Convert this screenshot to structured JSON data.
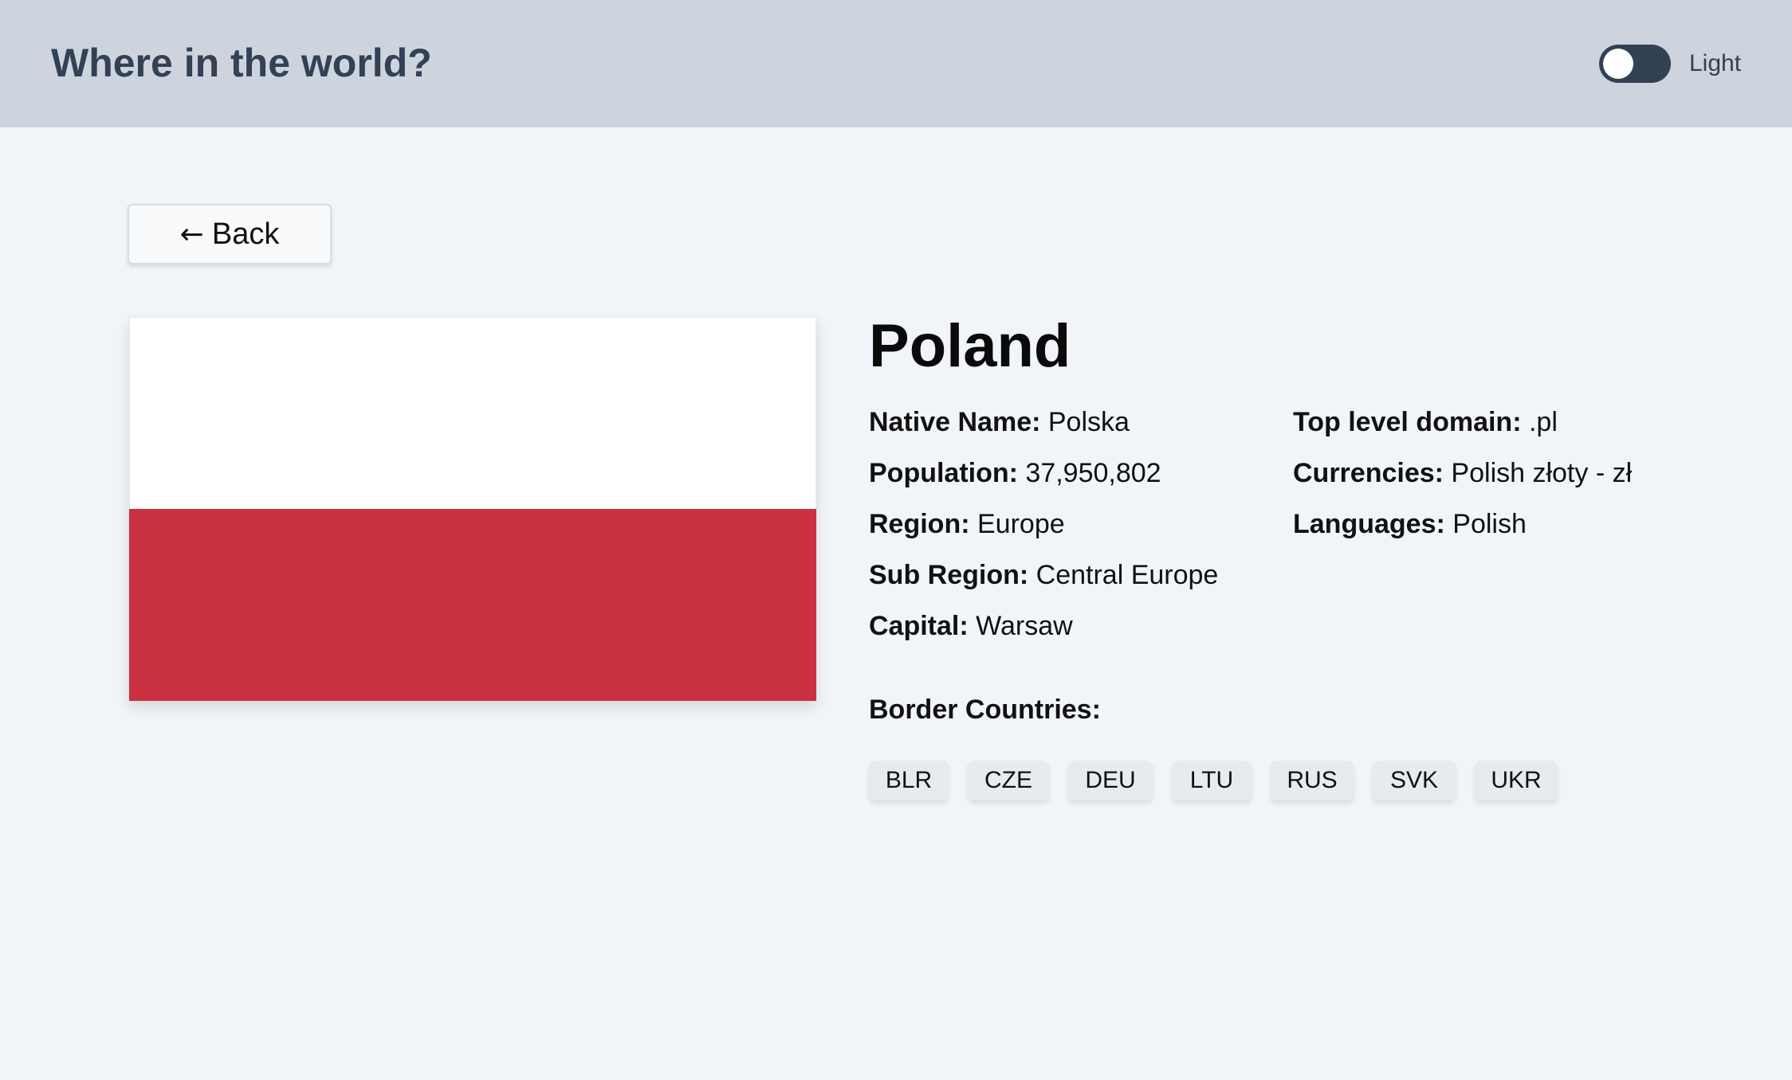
{
  "header": {
    "title": "Where in the world?",
    "theme_label": "Light"
  },
  "nav": {
    "back_label": "Back",
    "back_icon": "arrow-left-icon"
  },
  "flag": {
    "colors": [
      "#ffffff",
      "#c93140"
    ]
  },
  "country": {
    "name": "Poland",
    "left_details": [
      {
        "label": "Native Name:",
        "value": "Polska"
      },
      {
        "label": "Population:",
        "value": "37,950,802"
      },
      {
        "label": "Region:",
        "value": "Europe"
      },
      {
        "label": "Sub Region:",
        "value": "Central Europe"
      },
      {
        "label": "Capital:",
        "value": "Warsaw"
      }
    ],
    "right_details": [
      {
        "label": "Top level domain:",
        "value": ".pl"
      },
      {
        "label": "Currencies:",
        "value": "Polish złoty - zł"
      },
      {
        "label": "Languages:",
        "value": "Polish"
      }
    ],
    "border_title": "Border Countries:",
    "borders": [
      "BLR",
      "CZE",
      "DEU",
      "LTU",
      "RUS",
      "SVK",
      "UKR"
    ]
  },
  "colors": {
    "header_bg": "#cdd4de",
    "page_bg": "#f1f5f9",
    "toggle_bg": "#334155",
    "title_text": "#334155"
  }
}
